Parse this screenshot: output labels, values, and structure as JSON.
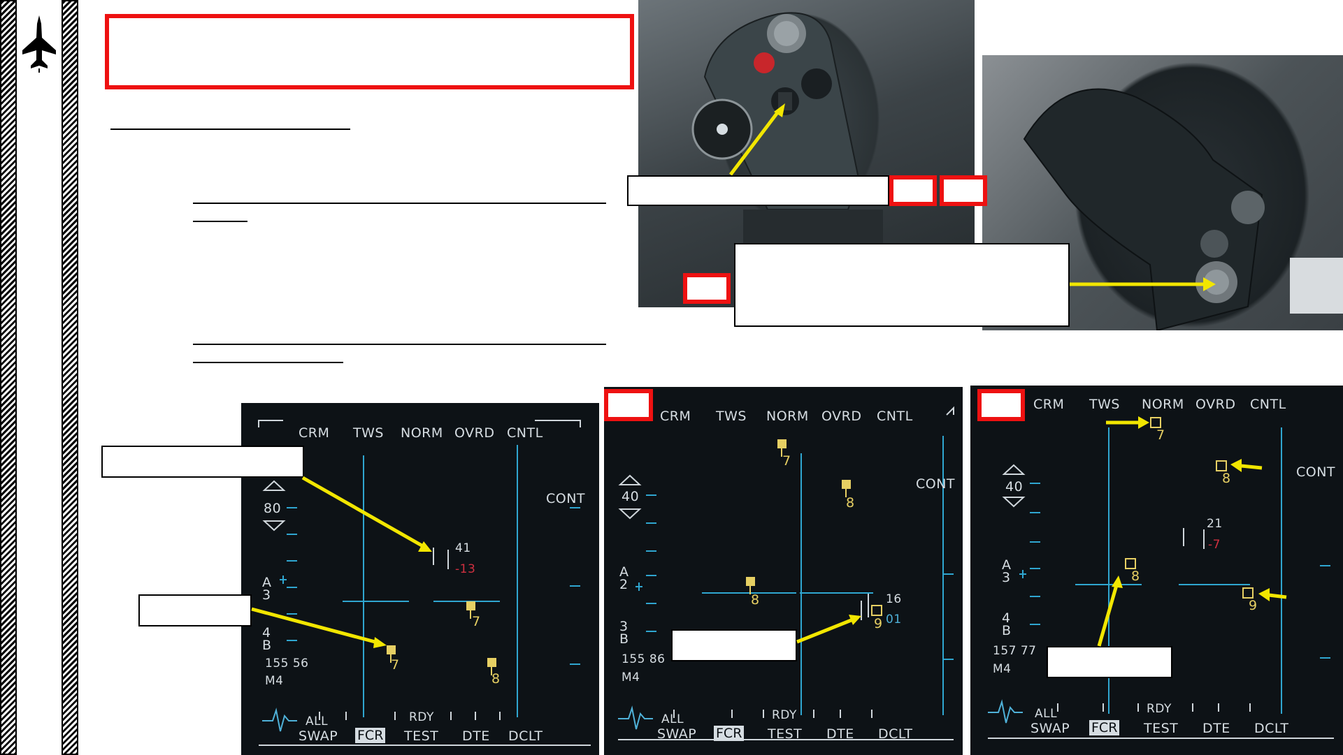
{
  "sidebar": {
    "logo_icon": "jet-silhouette-icon"
  },
  "colors": {
    "accent_red": "#e11111",
    "arrow_yellow": "#f2e600",
    "radar_bg": "#0d1216",
    "radar_text": "#d6dde2",
    "target_yellow": "#e6cf63",
    "cursor_cyan": "#4fb1d8",
    "altitude_red": "#d03040"
  },
  "screens": [
    {
      "id": "left",
      "top_labels": [
        "CRM",
        "TWS",
        "NORM",
        "OVRD",
        "CNTL"
      ],
      "range": "80",
      "side_label": "CONT",
      "azimuth": [
        "A",
        "3"
      ],
      "bars": [
        "4",
        "B"
      ],
      "readout": "155 56",
      "mode": "M4",
      "cursor_alt_top": "41",
      "cursor_alt_bottom": "-13",
      "targets": [
        "7",
        "7",
        "8"
      ],
      "bottom_top": [
        "ALL",
        "RDY"
      ],
      "bottom_labels": [
        "SWAP",
        "FCR",
        "TEST",
        "DTE",
        "DCLT"
      ]
    },
    {
      "id": "middle",
      "top_labels": [
        "CRM",
        "TWS",
        "NORM",
        "OVRD",
        "CNTL"
      ],
      "range": "40",
      "side_label": "CONT",
      "azimuth": [
        "A",
        "2"
      ],
      "bars": [
        "3",
        "B"
      ],
      "readout": "155 86",
      "mode": "M4",
      "cursor_alt_top": "16",
      "cursor_alt_bottom": "01",
      "targets": [
        "7",
        "8",
        "8",
        "9"
      ],
      "bottom_top": [
        "ALL",
        "RDY"
      ],
      "bottom_labels": [
        "SWAP",
        "FCR",
        "TEST",
        "DTE",
        "DCLT"
      ]
    },
    {
      "id": "right",
      "top_labels": [
        "CRM",
        "TWS",
        "NORM",
        "OVRD",
        "CNTL"
      ],
      "range": "40",
      "side_label": "CONT",
      "azimuth": [
        "A",
        "3"
      ],
      "bars": [
        "4",
        "B"
      ],
      "readout": "157 77",
      "mode": "M4",
      "cursor_alt_top": "21",
      "cursor_alt_bottom": "-7",
      "targets": [
        "7",
        "8",
        "8",
        "9"
      ],
      "bottom_top": [
        "ALL",
        "RDY"
      ],
      "bottom_labels": [
        "SWAP",
        "FCR",
        "TEST",
        "DTE",
        "DCLT"
      ]
    }
  ]
}
